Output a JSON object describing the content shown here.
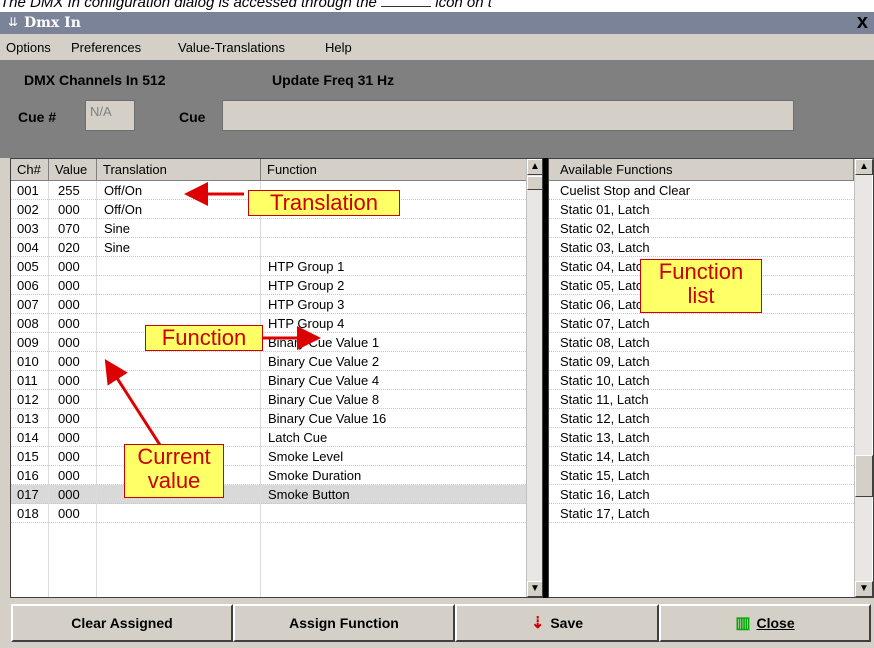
{
  "caption": {
    "before": "The DMX In configuration dialog is accessed through the",
    "after": "icon on t"
  },
  "window": {
    "title": "Dmx In",
    "close": "x"
  },
  "menu": [
    "Options",
    "Preferences",
    "Value-Translations",
    "Help"
  ],
  "info": {
    "channels": "DMX Channels In 512",
    "update": "Update Freq 31 Hz",
    "cue_num_label": "Cue #",
    "cue_num_value": "N/A",
    "cue_label": "Cue",
    "cue_value": ""
  },
  "left_grid": {
    "headers": [
      "Ch#",
      "Value",
      "Translation",
      "Function"
    ],
    "rows": [
      {
        "ch": "001",
        "value": "255",
        "translation": "Off/On",
        "function": ""
      },
      {
        "ch": "002",
        "value": "000",
        "translation": "Off/On",
        "function": ""
      },
      {
        "ch": "003",
        "value": "070",
        "translation": "Sine",
        "function": ""
      },
      {
        "ch": "004",
        "value": "020",
        "translation": "Sine",
        "function": ""
      },
      {
        "ch": "005",
        "value": "000",
        "translation": "",
        "function": "HTP Group 1"
      },
      {
        "ch": "006",
        "value": "000",
        "translation": "",
        "function": "HTP Group 2"
      },
      {
        "ch": "007",
        "value": "000",
        "translation": "",
        "function": "HTP Group 3"
      },
      {
        "ch": "008",
        "value": "000",
        "translation": "",
        "function": "HTP Group 4"
      },
      {
        "ch": "009",
        "value": "000",
        "translation": "",
        "function": "Binary Cue Value 1"
      },
      {
        "ch": "010",
        "value": "000",
        "translation": "",
        "function": "Binary Cue Value 2"
      },
      {
        "ch": "011",
        "value": "000",
        "translation": "",
        "function": "Binary Cue Value 4"
      },
      {
        "ch": "012",
        "value": "000",
        "translation": "",
        "function": "Binary Cue Value 8"
      },
      {
        "ch": "013",
        "value": "000",
        "translation": "",
        "function": "Binary Cue Value 16"
      },
      {
        "ch": "014",
        "value": "000",
        "translation": "",
        "function": "Latch Cue"
      },
      {
        "ch": "015",
        "value": "000",
        "translation": "",
        "function": "Smoke Level"
      },
      {
        "ch": "016",
        "value": "000",
        "translation": "",
        "function": "Smoke Duration"
      },
      {
        "ch": "017",
        "value": "000",
        "translation": "",
        "function": "Smoke Button"
      },
      {
        "ch": "018",
        "value": "000",
        "translation": "",
        "function": ""
      }
    ]
  },
  "right_grid": {
    "header": "Available Functions",
    "items": [
      "Cuelist Stop and Clear",
      "Static 01, Latch",
      "Static 02, Latch",
      "Static 03, Latch",
      "Static 04, Latch",
      "Static 05, Latch",
      "Static 06, Latch",
      "Static 07, Latch",
      "Static 08, Latch",
      "Static 09, Latch",
      "Static 10, Latch",
      "Static 11, Latch",
      "Static 12, Latch",
      "Static 13, Latch",
      "Static 14, Latch",
      "Static 15, Latch",
      "Static 16, Latch",
      "Static 17, Latch"
    ]
  },
  "annotations": {
    "translation": "Translation",
    "function": "Function",
    "current_value_1": "Current",
    "current_value_2": "value",
    "function_list_1": "Function",
    "function_list_2": "list"
  },
  "buttons": {
    "clear": "Clear Assigned",
    "assign": "Assign Function",
    "save": "Save",
    "close": "Close"
  },
  "selected_row": 16
}
